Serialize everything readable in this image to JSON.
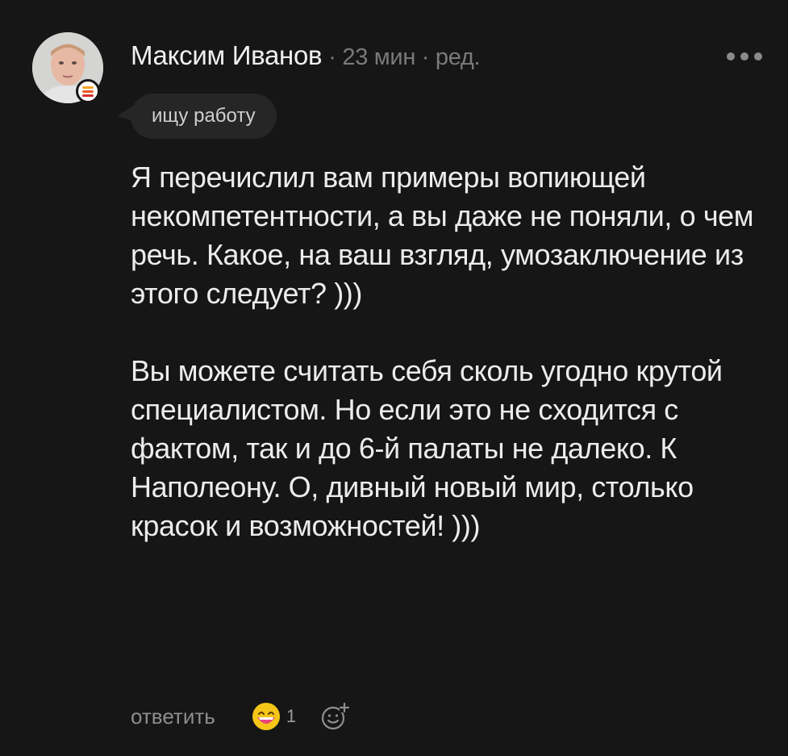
{
  "comment": {
    "author": "Максим Иванов",
    "meta": "· 23 мин · ред.",
    "status_tag": "ищу работу",
    "paragraphs": [
      "Я перечислил вам примеры вопиющей некомпетентности, а вы даже не поняли, о чем речь. Какое, на ваш взгляд, умозаключение из этого следует? )))",
      "Вы можете считать себя сколь угодно крутой специалистом. Но если это не сходится с фактом, так и до 6-й палаты не далеко. К Наполеону. О, дивный новый мир, столько красок и возможностей! )))"
    ],
    "actions": {
      "reply_label": "ответить",
      "reaction_icon": "grinning-face-emoji-icon",
      "reaction_count": "1",
      "add_reaction_icon": "add-reaction-icon"
    }
  },
  "colors": {
    "background": "#161616",
    "tag_background": "#262626",
    "badge_stripes": [
      "#f4a52a",
      "#ee5a24",
      "#d63031"
    ]
  }
}
